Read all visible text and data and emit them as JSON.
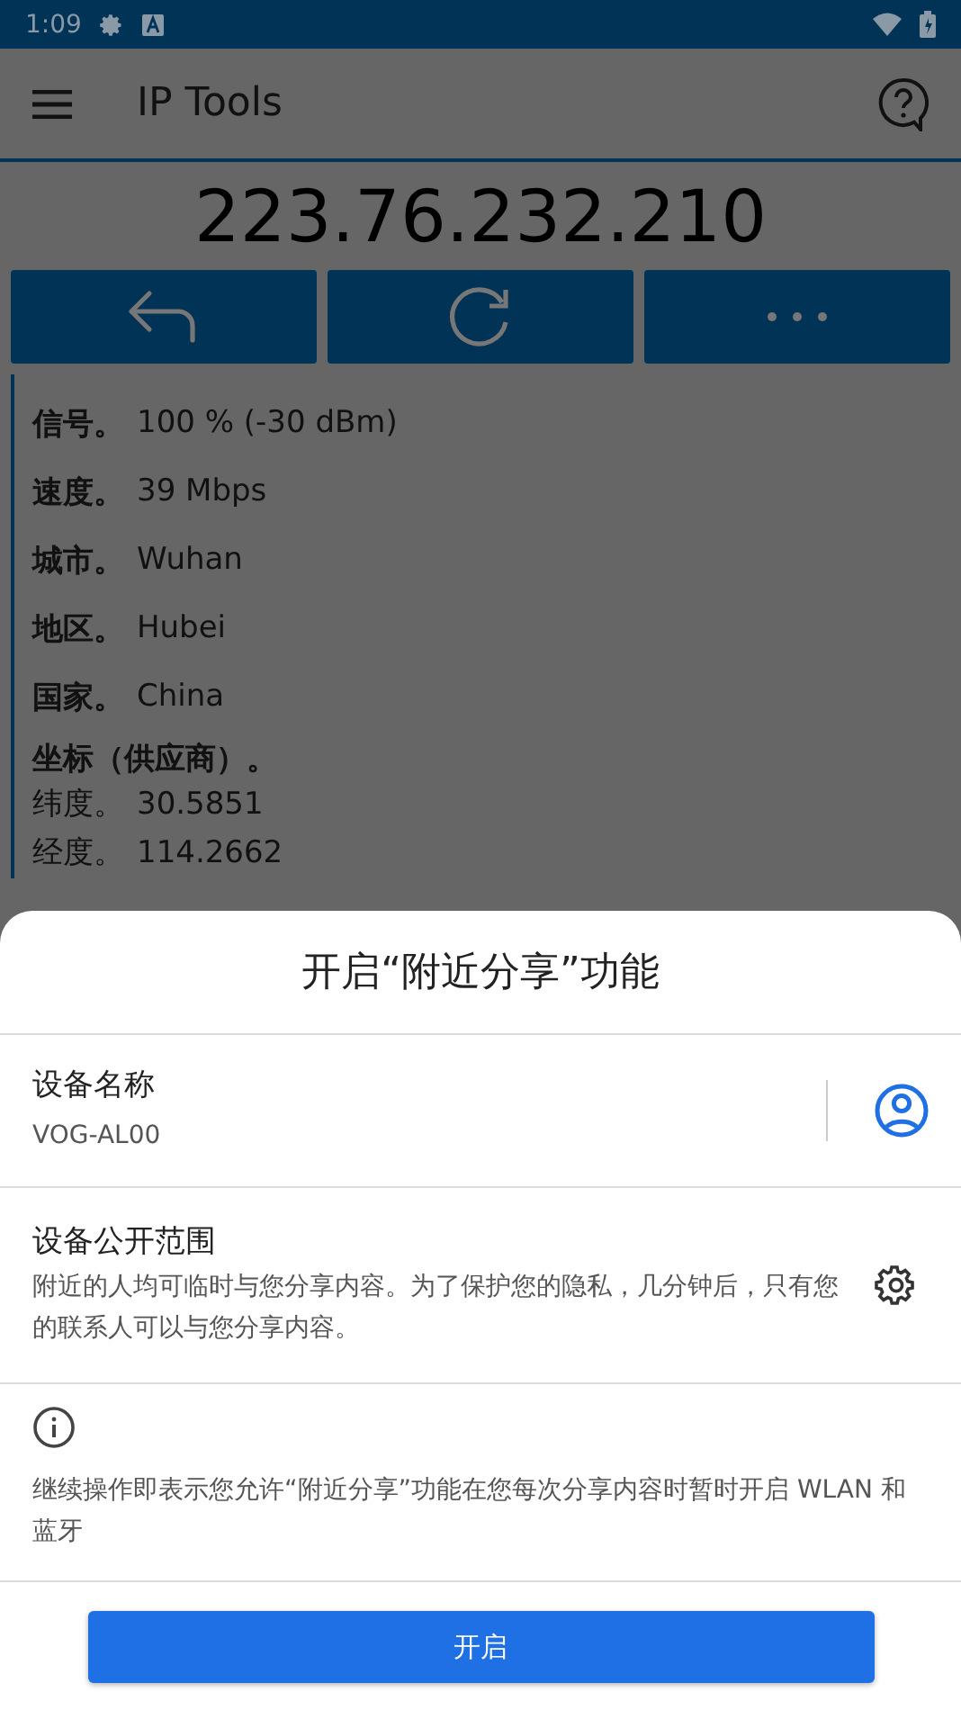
{
  "status_bar": {
    "time": "1:09"
  },
  "app_bar": {
    "title": "IP Tools"
  },
  "ip_address": "223.76.232.210",
  "info": {
    "rows": [
      {
        "label": "信号。",
        "value": "100 % (-30 dBm)"
      },
      {
        "label": "速度。",
        "value": "39 Mbps"
      },
      {
        "label": "城市。",
        "value": "Wuhan"
      },
      {
        "label": "地区。",
        "value": "Hubei"
      },
      {
        "label": "国家。",
        "value": "China"
      }
    ],
    "coordinates": {
      "heading": "坐标（供应商）。",
      "rows": [
        {
          "label": "纬度。",
          "value": "30.5851"
        },
        {
          "label": "经度。",
          "value": "114.2662"
        }
      ]
    }
  },
  "sheet": {
    "title": "开启“附近分享”功能",
    "device_name": {
      "label": "设备名称",
      "value": "VOG-AL00"
    },
    "visibility": {
      "label": "设备公开范围",
      "description": "附近的人均可临时与您分享内容。为了保护您的隐私，几分钟后，只有您的联系人可以与您分享内容。"
    },
    "notice": "继续操作即表示您允许“附近分享”功能在您每次分享内容时暂时开启 WLAN 和蓝牙",
    "button": "开启"
  }
}
